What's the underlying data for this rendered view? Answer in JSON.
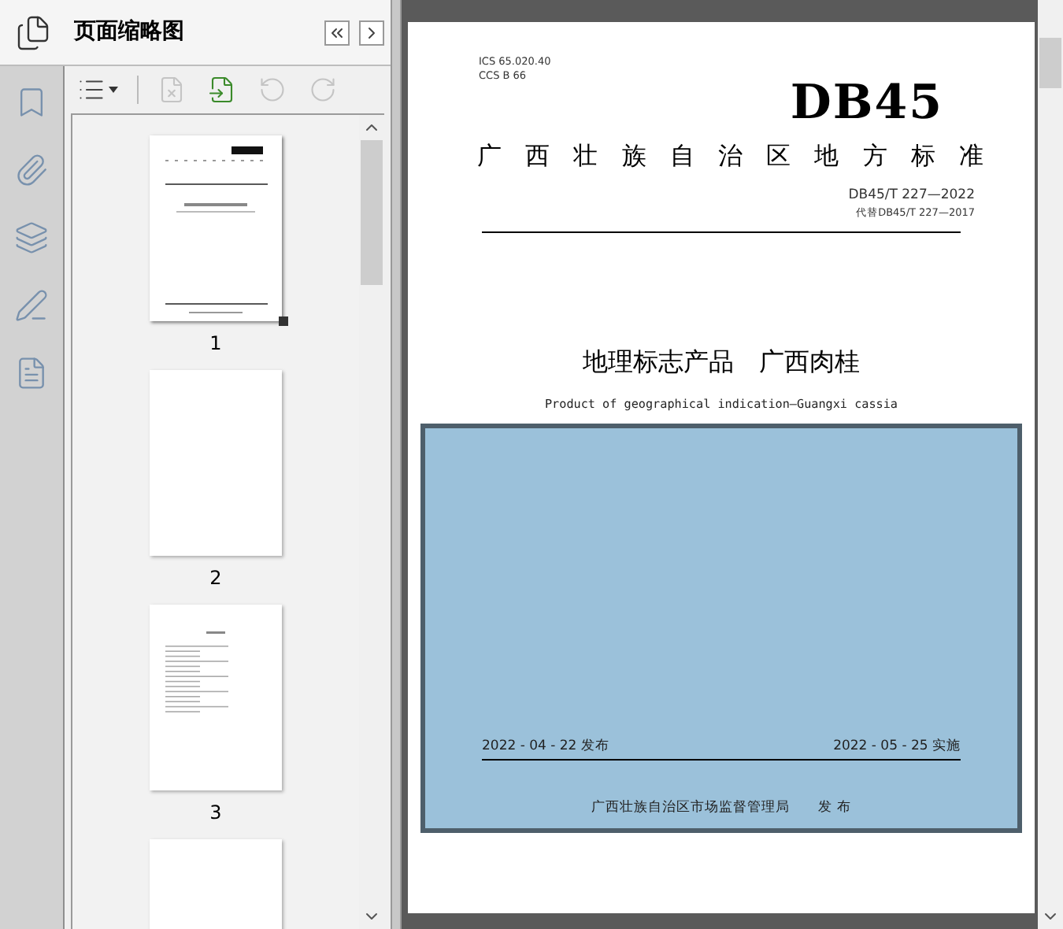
{
  "panel": {
    "title": "页面缩略图"
  },
  "rail": [
    {
      "kind": "bookmark",
      "selected": false
    },
    {
      "kind": "attachment",
      "selected": false
    },
    {
      "kind": "layers",
      "selected": false
    },
    {
      "kind": "signature",
      "selected": false
    },
    {
      "kind": "document",
      "selected": false
    }
  ],
  "toolbar": [
    {
      "kind": "options",
      "disabled": false
    },
    {
      "kind": "delete",
      "disabled": true
    },
    {
      "kind": "insert",
      "disabled": false
    },
    {
      "kind": "rotate-left",
      "disabled": true
    },
    {
      "kind": "rotate-right",
      "disabled": true
    }
  ],
  "thumbnails": [
    {
      "label": "1",
      "kind": "cover",
      "selected": true
    },
    {
      "label": "2",
      "kind": "blank",
      "selected": false
    },
    {
      "label": "3",
      "kind": "contents",
      "selected": false
    },
    {
      "kind": "blank",
      "selected": false
    }
  ],
  "document": {
    "ics": "ICS  65.020.40",
    "ccs": "CCS B 66",
    "logo": "DB45",
    "heading": "广西壮族自治区地方标准",
    "number": "DB45/T 227—2022",
    "replaces": "代替DB45/T 227—2017",
    "title": "地理标志产品　广西肉桂",
    "subtitle": "Product of geographical indication—Guangxi cassia",
    "issue_date": "2022 - 04 - 22 发布",
    "effective_date": "2022 - 05 - 25 实施",
    "issuer": "广西壮族自治区市场监督管理局　　发 布",
    "selected_region": true
  }
}
